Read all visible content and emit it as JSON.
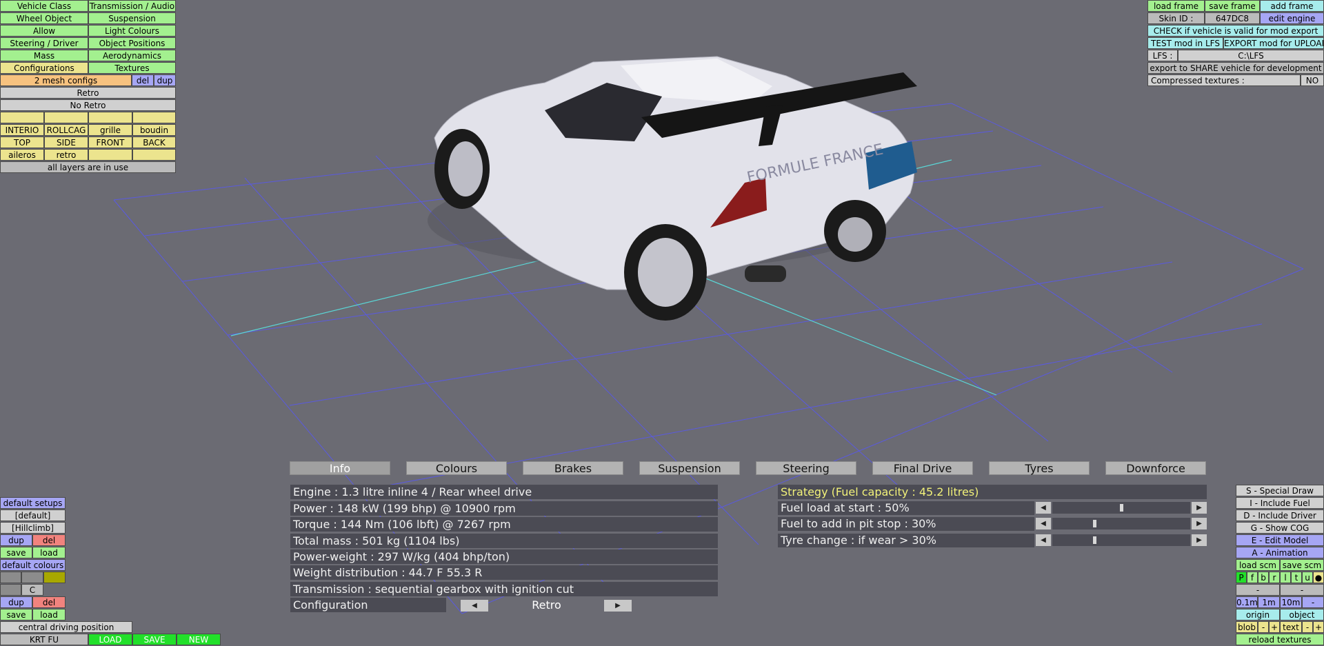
{
  "left_menu": {
    "rows": [
      [
        "Vehicle Class",
        "Transmission / Audio"
      ],
      [
        "Wheel Object",
        "Suspension"
      ],
      [
        "Allow",
        "Light Colours"
      ],
      [
        "Steering / Driver",
        "Object Positions"
      ],
      [
        "Mass",
        "Aerodynamics"
      ],
      [
        "Configurations",
        "Textures"
      ]
    ],
    "mesh_configs": "2 mesh configs",
    "del": "del",
    "dup": "dup",
    "configs": [
      "Retro",
      "No Retro"
    ],
    "layers": [
      [
        "",
        "",
        "",
        ""
      ],
      [
        "INTERIO",
        "ROLLCAG",
        "grille",
        "boudin"
      ],
      [
        "TOP",
        "SIDE",
        "FRONT",
        "BACK"
      ],
      [
        "aileros",
        "retro",
        "",
        ""
      ]
    ],
    "layers_status": "all layers are in use"
  },
  "top_right": {
    "load_frame": "load frame",
    "save_frame": "save frame",
    "add_frame": "add frame",
    "skin_id_label": "Skin ID :",
    "skin_id_value": "647DC8",
    "edit_engine": "edit engine",
    "check_valid": "CHECK if vehicle is valid for mod export",
    "test_mod": "TEST mod in LFS",
    "export_mod": "EXPORT mod for UPLOAD",
    "lfs_label": "LFS :",
    "lfs_path": "C:\\LFS",
    "export_share": "export to SHARE vehicle for development",
    "compressed_label": "Compressed textures :",
    "compressed_value": "NO"
  },
  "car_livery_text": "FORMULE FRANCE",
  "tabs": [
    "Info",
    "Colours",
    "Brakes",
    "Suspension",
    "Steering",
    "Final Drive",
    "Tyres",
    "Downforce"
  ],
  "info": {
    "lines": [
      "Engine : 1.3 litre inline 4 / Rear wheel drive",
      "Power : 148 kW (199 bhp) @ 10900 rpm",
      "Torque : 144 Nm (106 lbft) @ 7267 rpm",
      "Total mass : 501 kg (1104 lbs)",
      "Power-weight : 297 W/kg (404 bhp/ton)",
      "Weight distribution : 44.7 F  55.3 R",
      "Transmission : sequential gearbox with ignition cut"
    ],
    "configuration_label": "Configuration",
    "configuration_value": "Retro"
  },
  "strategy": {
    "title": "Strategy (Fuel capacity : 45.2 litres)",
    "rows": [
      {
        "label": "Fuel load at start : 50%",
        "level": 0.5
      },
      {
        "label": "Fuel to add in pit stop : 30%",
        "level": 0.3
      },
      {
        "label": "Tyre change : if wear > 30%",
        "level": 0.3
      }
    ]
  },
  "bottom_left": {
    "default_setups": "default setups",
    "default": "[default]",
    "hillclimb": "[Hillclimb]",
    "dup": "dup",
    "del": "del",
    "save": "save",
    "load": "load",
    "default_colours": "default colours",
    "c": "C",
    "central_driving": "central driving position",
    "krt_fu": "KRT FU",
    "load_btn": "LOAD",
    "save_btn": "SAVE",
    "new_btn": "NEW"
  },
  "bottom_right": {
    "special_draw": "S - Special Draw",
    "include_fuel": "I - Include Fuel",
    "include_driver": "D - Include Driver",
    "show_cog": "G - Show COG",
    "edit_model": "E - Edit Model",
    "animation": "A - Animation",
    "load_scm": "load scm",
    "save_scm": "save scm",
    "letters": [
      "P",
      "f",
      "b",
      "r",
      "l",
      "t",
      "u",
      "●"
    ],
    "minus": "-",
    "scale": [
      "0.1m",
      "1m",
      "10m",
      "-"
    ],
    "origin": "origin",
    "object": "object",
    "blob": "blob",
    "text": "text",
    "plus": "+",
    "reload_textures": "reload textures"
  },
  "colors": {
    "background": "#6b6b73",
    "grid_line": "#5a5ae0",
    "axis_line": "#5ad7d7",
    "car_body": "#e2e2ea",
    "livery_red": "#8a1c1c",
    "livery_blue": "#1f5c8f"
  }
}
